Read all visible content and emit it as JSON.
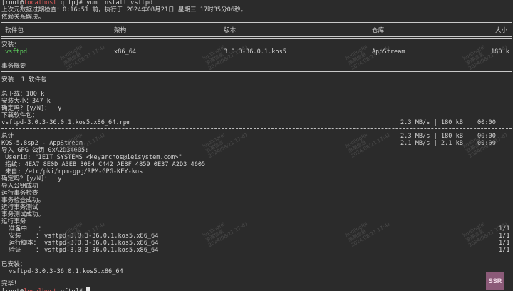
{
  "prompt": {
    "user": "root",
    "host": "localhost",
    "dir": "qftp",
    "command": "yum install vsftpd"
  },
  "meta_line": "上次元数据过期检查：0:16:51 前，执行于 2024年08月21日 星期三 17时35分06秒。",
  "dep_line": "依赖关系解决。",
  "table_headers": {
    "package": "软件包",
    "arch": "架构",
    "version": "版本",
    "repo": "仓库",
    "size": "大小"
  },
  "installing_label": "安装：",
  "package_row": {
    "name": "vsftpd",
    "arch": "x86_64",
    "version": "3.0.3-36.0.1.kos5",
    "repo": "AppStream",
    "size": "180 k"
  },
  "transaction_summary": "事务概要",
  "install_count": "安装  1 软件包",
  "total_download": "总下载：180 k",
  "install_size": "安装大小：347 k",
  "confirm1": "确定吗？[y/N]：  y",
  "downloading": "下载软件包：",
  "download_file": {
    "name": "vsftpd-3.0.3-36.0.1.kos5.x86_64.rpm",
    "speed": "2.3 MB/s | 180 kB",
    "time": "00:00"
  },
  "total_line": {
    "label": "总计",
    "speed": "2.3 MB/s | 180 kB",
    "time": "00:00"
  },
  "kos_line": {
    "label": "KOS-5.8sp2 - AppStream",
    "speed": "2.1 MB/s | 2.1 kB",
    "time": "00:00"
  },
  "gpg_lines": [
    "导入 GPG 公钥 0xA2D34605:",
    " Userid: \"IEIT SYSTEMS <keyarchos@ieisystem.com>\"",
    " 指纹: 4EA7 8E0D A3EB 30E4 C442 AE8F 4859 0E37 A2D3 4605",
    " 来自: /etc/pki/rpm-gpg/RPM-GPG-KEY-kos"
  ],
  "confirm2": "确定吗？[y/N]：  y",
  "steps": [
    "导入公钥成功",
    "运行事务检查",
    "事务检查成功。",
    "运行事务测试",
    "事务测试成功。",
    "运行事务"
  ],
  "tx_rows": [
    {
      "label": "  准备中   ：",
      "pkg": "",
      "count": "1/1"
    },
    {
      "label": "  安装    ：",
      "pkg": "vsftpd-3.0.3-36.0.1.kos5.x86_64",
      "count": "1/1"
    },
    {
      "label": "  运行脚本：",
      "pkg": "vsftpd-3.0.3-36.0.1.kos5.x86_64",
      "count": "1/1"
    },
    {
      "label": "  验证    ：",
      "pkg": "vsftpd-3.0.3-36.0.1.kos5.x86_64",
      "count": "1/1"
    }
  ],
  "installed_label": "已安装：",
  "installed_pkg": "  vsftpd-3.0.3-36.0.1.kos5.x86_64",
  "done": "完毕！",
  "final_prompt": {
    "user": "root",
    "host": "localhost",
    "dir": "qftp"
  },
  "watermark": {
    "line1": "huolingfei",
    "line2": "浪潮信息",
    "line3": "2024/08/21 17:41"
  },
  "badge": "SSR"
}
